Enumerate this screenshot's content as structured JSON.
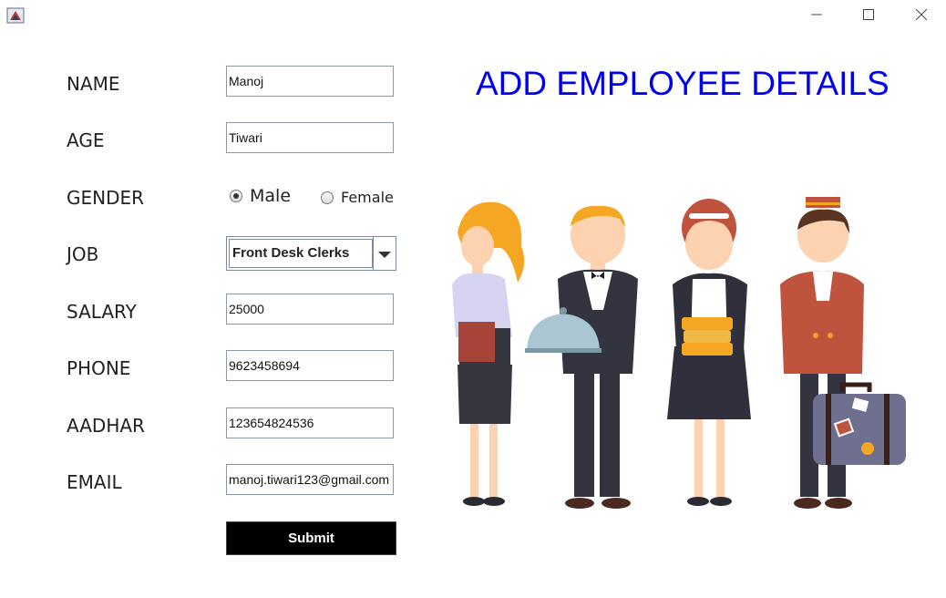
{
  "window": {
    "minimize_icon": "minimize-icon",
    "maximize_icon": "maximize-icon",
    "close_icon": "close-icon"
  },
  "heading": "ADD EMPLOYEE DETAILS",
  "colors": {
    "heading": "#0000ee",
    "submit_bg": "#000000",
    "submit_text": "#ffffff"
  },
  "form": {
    "name_label": "NAME",
    "name_value": "Manoj",
    "age_label": "AGE",
    "age_value": "Tiwari",
    "gender_label": "GENDER",
    "gender_options": [
      "Male",
      "Female"
    ],
    "gender_selected": "Male",
    "job_label": "JOB",
    "job_value": "Front Desk Clerks",
    "salary_label": "SALARY",
    "salary_value": "25000",
    "phone_label": "PHONE",
    "phone_value": "9623458694",
    "aadhar_label": "AADHAR",
    "aadhar_value": "123654824536",
    "email_label": "EMAIL",
    "email_value": "manoj.tiwari123@gmail.com",
    "submit_label": "Submit"
  },
  "illustration": {
    "subject": "hotel-staff-illustration"
  }
}
